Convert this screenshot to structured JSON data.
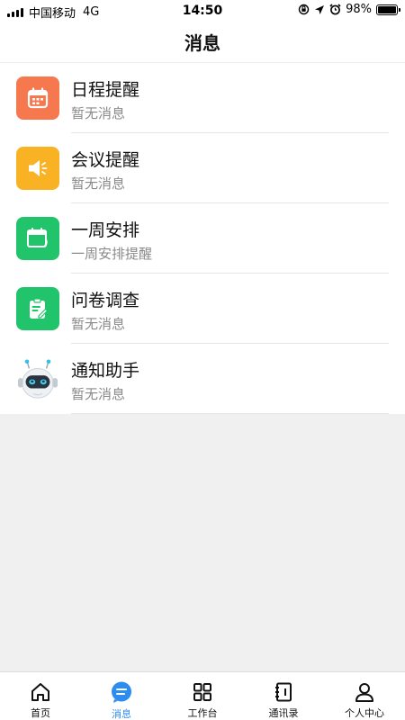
{
  "status_bar": {
    "carrier": "中国移动",
    "network": "4G",
    "time": "14:50",
    "battery": "98%",
    "battery_level": 0.98
  },
  "header": {
    "title": "消息"
  },
  "messages": [
    {
      "title": "日程提醒",
      "subtitle": "暂无消息",
      "icon": "calendar-icon",
      "color": "#f5784e"
    },
    {
      "title": "会议提醒",
      "subtitle": "暂无消息",
      "icon": "speaker-icon",
      "color": "#f9b224"
    },
    {
      "title": "一周安排",
      "subtitle": "一周安排提醒",
      "icon": "calendar-week-icon",
      "color": "#22c46b"
    },
    {
      "title": "问卷调查",
      "subtitle": "暂无消息",
      "icon": "clipboard-edit-icon",
      "color": "#22c46b"
    },
    {
      "title": "通知助手",
      "subtitle": "暂无消息",
      "icon": "robot-icon",
      "color": "#ffffff"
    }
  ],
  "tab_bar": {
    "items": [
      {
        "label": "首页",
        "icon": "home-icon",
        "active": false
      },
      {
        "label": "消息",
        "icon": "message-icon",
        "active": true
      },
      {
        "label": "工作台",
        "icon": "grid-icon",
        "active": false
      },
      {
        "label": "通讯录",
        "icon": "address-book-icon",
        "active": false
      },
      {
        "label": "个人中心",
        "icon": "person-icon",
        "active": false
      }
    ],
    "active_color": "#2d8cf0"
  }
}
